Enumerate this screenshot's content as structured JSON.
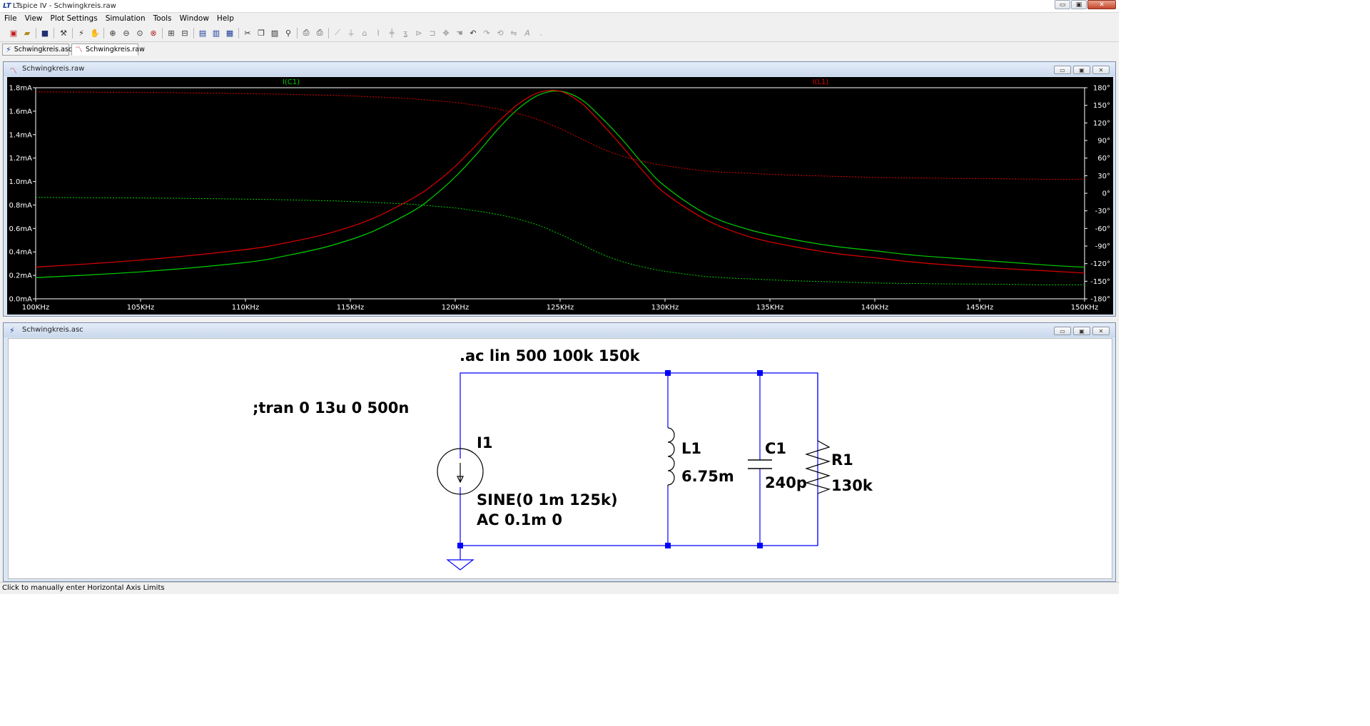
{
  "app": {
    "title": "LTspice IV - Schwingkreis.raw",
    "icon": "ltspice-logo-icon"
  },
  "menu": [
    "File",
    "View",
    "Plot Settings",
    "Simulation",
    "Tools",
    "Window",
    "Help"
  ],
  "toolbar_icons": [
    "new-schematic-icon",
    "open-icon",
    "save-icon",
    "control-panel-icon",
    "run-icon",
    "halt-icon",
    "zoom-in-icon",
    "zoom-out-icon",
    "zoom-fit-icon",
    "zoom-cancel-icon",
    "autorange-icon",
    "mark-icon",
    "tile-horizontal-icon",
    "tile-vertical-icon",
    "cascade-icon",
    "cut-icon",
    "copy-icon",
    "paste-icon",
    "find-icon",
    "print-setup-icon",
    "print-icon",
    "wire-icon",
    "ground-icon",
    "label-net-icon",
    "resistor-icon",
    "capacitor-icon",
    "inductor-icon",
    "diode-icon",
    "component-icon",
    "move-icon",
    "drag-icon",
    "undo-icon",
    "redo-icon",
    "rotate-icon",
    "mirror-icon",
    "text-icon",
    "spice-directive-icon"
  ],
  "doc_tabs": [
    {
      "label": "Schwingkreis.asc",
      "icon": "schematic-icon",
      "active": false
    },
    {
      "label": "Schwingkreis.raw",
      "icon": "waveform-icon",
      "active": true
    }
  ],
  "waveform_window": {
    "title": "Schwingkreis.raw",
    "icon": "waveform-icon"
  },
  "schematic_window": {
    "title": "Schwingkreis.asc",
    "icon": "schematic-icon"
  },
  "window_buttons": {
    "minimize": "▭",
    "restore": "▣",
    "close": "✕"
  },
  "chart_data": {
    "type": "line",
    "background": "#000000",
    "xlim": [
      100,
      150
    ],
    "x_tick_labels": [
      "100KHz",
      "105KHz",
      "110KHz",
      "115KHz",
      "120KHz",
      "125KHz",
      "130KHz",
      "135KHz",
      "140KHz",
      "145KHz",
      "150KHz"
    ],
    "ylim": [
      0.0,
      1.8
    ],
    "y_tick_labels": [
      "0.0mA",
      "0.2mA",
      "0.4mA",
      "0.6mA",
      "0.8mA",
      "1.0mA",
      "1.2mA",
      "1.4mA",
      "1.6mA",
      "1.8mA"
    ],
    "y2lim": [
      -180,
      180
    ],
    "y2_tick_labels": [
      "-180°",
      "-150°",
      "-120°",
      "-90°",
      "-60°",
      "-30°",
      "0°",
      "30°",
      "60°",
      "90°",
      "120°",
      "150°",
      "180°"
    ],
    "grid": false,
    "series": [
      {
        "name": "I(C1)",
        "color": "#00d000",
        "magnitude": {
          "x": [
            100,
            105,
            110,
            112,
            114,
            116,
            118,
            119,
            120,
            121,
            122,
            123,
            124,
            125,
            126,
            127,
            128,
            129,
            130,
            132,
            134,
            136,
            138,
            140,
            142,
            145,
            148,
            150
          ],
          "y": [
            0.18,
            0.23,
            0.31,
            0.37,
            0.45,
            0.57,
            0.75,
            0.88,
            1.04,
            1.23,
            1.44,
            1.62,
            1.74,
            1.77,
            1.7,
            1.54,
            1.35,
            1.14,
            0.96,
            0.72,
            0.59,
            0.51,
            0.45,
            0.41,
            0.37,
            0.33,
            0.29,
            0.27
          ]
        },
        "phase": {
          "x": [
            100,
            105,
            110,
            113,
            115,
            117,
            118,
            119,
            120,
            121,
            122,
            123,
            124,
            125,
            126,
            127,
            128,
            129,
            130,
            132,
            134,
            136,
            138,
            140,
            142,
            145,
            148,
            150
          ],
          "y": [
            -7,
            -8,
            -10,
            -12,
            -14,
            -17,
            -19,
            -22,
            -25,
            -30,
            -36,
            -44,
            -55,
            -70,
            -87,
            -104,
            -117,
            -126,
            -133,
            -142,
            -146,
            -149,
            -151,
            -153,
            -154,
            -155,
            -156,
            -156
          ]
        }
      },
      {
        "name": "I(L1)",
        "color": "#e00000",
        "magnitude": {
          "x": [
            100,
            105,
            110,
            112,
            114,
            116,
            118,
            119,
            120,
            121,
            122,
            123,
            124,
            125,
            126,
            127,
            128,
            129,
            130,
            132,
            134,
            136,
            138,
            140,
            142,
            145,
            148,
            150
          ],
          "y": [
            0.27,
            0.33,
            0.42,
            0.48,
            0.56,
            0.68,
            0.86,
            0.98,
            1.13,
            1.31,
            1.5,
            1.66,
            1.76,
            1.77,
            1.67,
            1.49,
            1.29,
            1.08,
            0.9,
            0.67,
            0.53,
            0.45,
            0.39,
            0.35,
            0.31,
            0.27,
            0.24,
            0.22
          ]
        },
        "phase": {
          "x": [
            100,
            105,
            110,
            113,
            115,
            117,
            118,
            119,
            120,
            121,
            122,
            123,
            124,
            125,
            126,
            127,
            128,
            129,
            130,
            132,
            134,
            136,
            138,
            140,
            142,
            145,
            148,
            150
          ],
          "y": [
            173,
            172,
            170,
            168,
            166,
            163,
            161,
            158,
            155,
            150,
            144,
            136,
            125,
            110,
            93,
            76,
            63,
            54,
            47,
            38,
            34,
            31,
            29,
            27,
            26,
            25,
            24,
            24
          ]
        }
      }
    ]
  },
  "schematic": {
    "directives": {
      "ac": ".ac lin 500 100k 150k",
      "tran": ";tran 0 13u 0 500n"
    },
    "source": {
      "ref": "I1",
      "value1": "SINE(0 1m 125k)",
      "value2": "AC 0.1m 0"
    },
    "inductor": {
      "ref": "L1",
      "value": "6.75m"
    },
    "capacitor": {
      "ref": "C1",
      "value": "240p"
    },
    "resistor": {
      "ref": "R1",
      "value": "130k"
    }
  },
  "status": "Click to manually enter Horizontal Axis Limits"
}
